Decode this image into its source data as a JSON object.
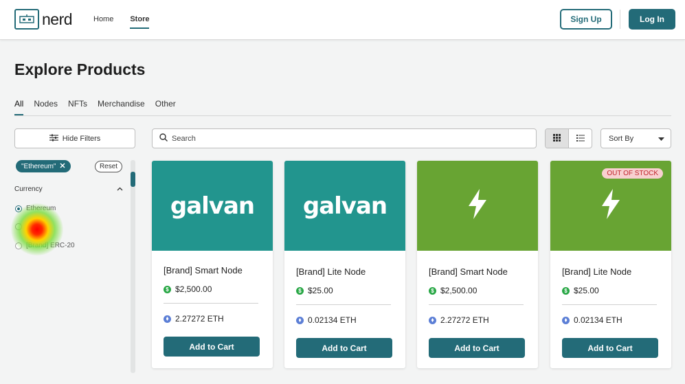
{
  "header": {
    "logo_text": "nerd",
    "nav": [
      {
        "label": "Home"
      },
      {
        "label": "Store"
      }
    ],
    "signup_label": "Sign Up",
    "login_label": "Log In"
  },
  "page": {
    "title": "Explore Products",
    "tabs": [
      {
        "label": "All"
      },
      {
        "label": "Nodes"
      },
      {
        "label": "NFTs"
      },
      {
        "label": "Merchandise"
      },
      {
        "label": "Other"
      }
    ],
    "active_tab": "All"
  },
  "toolbar": {
    "hide_filters_label": "Hide Filters",
    "search_placeholder": "Search",
    "sort_label": "Sort By"
  },
  "filters": {
    "active_chip": "\"Ethereum\"",
    "reset_label": "Reset",
    "currency_title": "Currency",
    "currency_options": [
      {
        "label": "Ethereum",
        "checked": true
      },
      {
        "label": "",
        "checked": false
      },
      {
        "label": "[Brand] ERC-20",
        "checked": false
      }
    ]
  },
  "products": [
    {
      "image_text": "galvan",
      "image_bg": "#22958e",
      "name": "[Brand] Smart Node",
      "price": "$2,500.00",
      "eth": "2.27272 ETH",
      "cta": "Add to Cart",
      "badge": ""
    },
    {
      "image_text": "galvan",
      "image_bg": "#22958e",
      "name": "[Brand] Lite Node",
      "price": "$25.00",
      "eth": "0.02134 ETH",
      "cta": "Add to Cart",
      "badge": ""
    },
    {
      "image_text": "",
      "image_bg": "#68a433",
      "name": "[Brand] Smart Node",
      "price": "$2,500.00",
      "eth": "2.27272 ETH",
      "cta": "Add to Cart",
      "badge": ""
    },
    {
      "image_text": "",
      "image_bg": "#68a433",
      "name": "[Brand] Lite Node",
      "price": "$25.00",
      "eth": "0.02134 ETH",
      "cta": "Add to Cart",
      "badge": "OUT OF STOCK"
    }
  ],
  "colors": {
    "accent": "#236b78",
    "teal_bg": "#22958e",
    "green_bg": "#68a433"
  }
}
